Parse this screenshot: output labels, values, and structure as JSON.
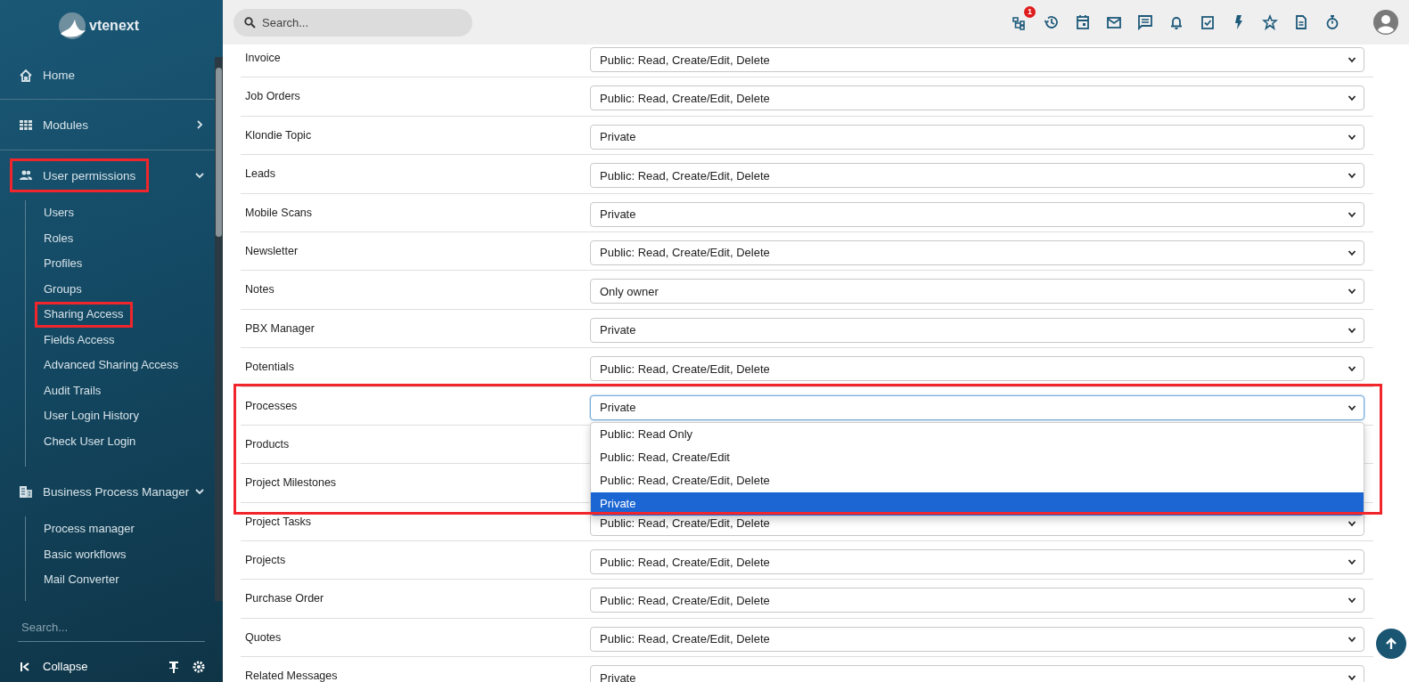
{
  "brand": "vtenext",
  "sidebar": {
    "items": [
      {
        "label": "Home",
        "highlighted": false
      },
      {
        "label": "Modules",
        "expanded": false,
        "highlighted": false
      },
      {
        "label": "User permissions",
        "expanded": true,
        "highlighted": true,
        "children": [
          {
            "label": "Users",
            "highlighted": false
          },
          {
            "label": "Roles",
            "highlighted": false
          },
          {
            "label": "Profiles",
            "highlighted": false
          },
          {
            "label": "Groups",
            "highlighted": false
          },
          {
            "label": "Sharing Access",
            "highlighted": true
          },
          {
            "label": "Fields Access",
            "highlighted": false
          },
          {
            "label": "Advanced Sharing Access",
            "highlighted": false
          },
          {
            "label": "Audit Trails",
            "highlighted": false
          },
          {
            "label": "User Login History",
            "highlighted": false
          },
          {
            "label": "Check User Login",
            "highlighted": false
          }
        ]
      },
      {
        "label": "Business Process Manager",
        "expanded": true,
        "highlighted": false,
        "children": [
          {
            "label": "Process manager",
            "highlighted": false
          },
          {
            "label": "Basic workflows",
            "highlighted": false
          },
          {
            "label": "Mail Converter",
            "highlighted": false
          }
        ]
      }
    ],
    "search": {
      "placeholder": "Search..."
    },
    "collapse": "Collapse"
  },
  "topbar": {
    "search": {
      "placeholder": "Search..."
    },
    "badge": "1"
  },
  "rows": [
    {
      "label": "Invoice",
      "value": "Public: Read, Create/Edit, Delete",
      "highlighted": false
    },
    {
      "label": "Job Orders",
      "value": "Public: Read, Create/Edit, Delete",
      "highlighted": false
    },
    {
      "label": "Klondie Topic",
      "value": "Private",
      "highlighted": false
    },
    {
      "label": "Leads",
      "value": "Public: Read, Create/Edit, Delete",
      "highlighted": false
    },
    {
      "label": "Mobile Scans",
      "value": "Private",
      "highlighted": false
    },
    {
      "label": "Newsletter",
      "value": "Public: Read, Create/Edit, Delete",
      "highlighted": false
    },
    {
      "label": "Notes",
      "value": "Only owner",
      "highlighted": false
    },
    {
      "label": "PBX Manager",
      "value": "Private",
      "highlighted": false
    },
    {
      "label": "Potentials",
      "value": "Public: Read, Create/Edit, Delete",
      "highlighted": false
    },
    {
      "label": "Processes",
      "value": "Private",
      "highlighted": true,
      "open": true,
      "options": [
        {
          "label": "Public: Read Only",
          "selected": false
        },
        {
          "label": "Public: Read, Create/Edit",
          "selected": false
        },
        {
          "label": "Public: Read, Create/Edit, Delete",
          "selected": false
        },
        {
          "label": "Private",
          "selected": true
        }
      ]
    },
    {
      "label": "Products",
      "highlighted": true
    },
    {
      "label": "Project Milestones",
      "highlighted": true
    },
    {
      "label": "Project Tasks",
      "value": "Public: Read, Create/Edit, Delete",
      "highlighted": false
    },
    {
      "label": "Projects",
      "value": "Public: Read, Create/Edit, Delete",
      "highlighted": false
    },
    {
      "label": "Purchase Order",
      "value": "Public: Read, Create/Edit, Delete",
      "highlighted": false
    },
    {
      "label": "Quotes",
      "value": "Public: Read, Create/Edit, Delete",
      "highlighted": false
    },
    {
      "label": "Related Messages",
      "value": "Private",
      "highlighted": false
    }
  ]
}
